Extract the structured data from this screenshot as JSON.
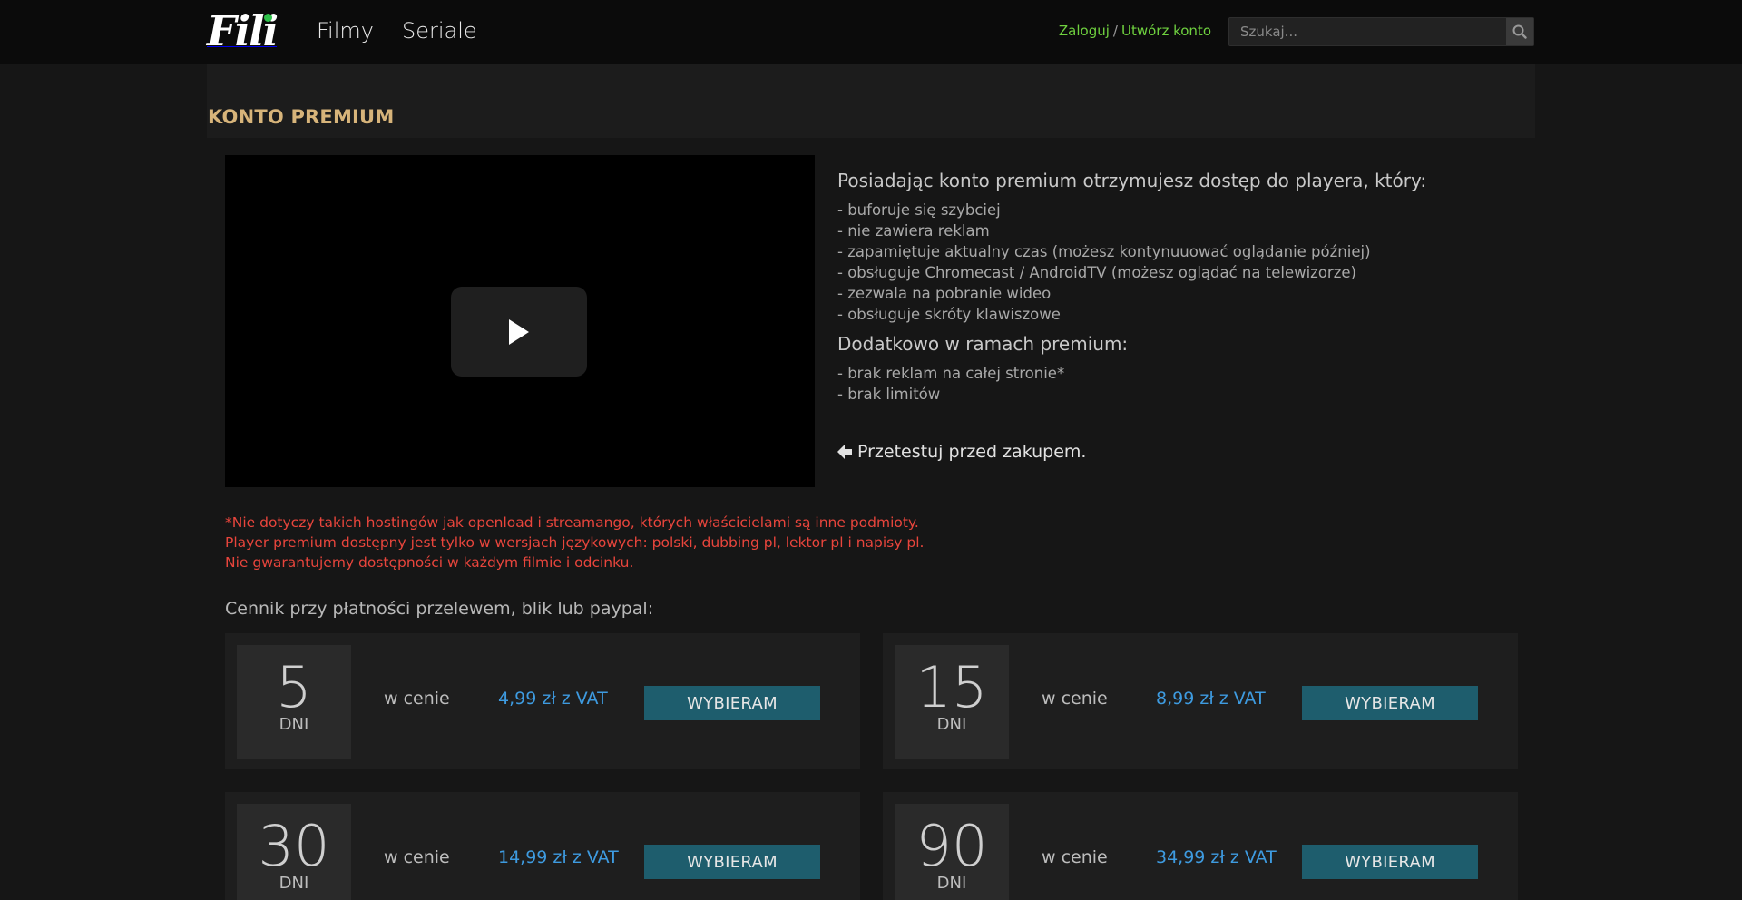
{
  "header": {
    "logo_text": "Fili",
    "nav": [
      {
        "label": "Filmy"
      },
      {
        "label": "Seriale"
      }
    ],
    "auth": {
      "login": "Zaloguj",
      "separator": "/",
      "register": "Utwórz konto"
    },
    "search": {
      "placeholder": "Szukaj..."
    }
  },
  "page": {
    "title": "KONTO PREMIUM",
    "description": {
      "heading": "Posiadając konto premium otrzymujesz dostęp do playera, który:",
      "features": [
        "- buforuje się szybciej",
        "- nie zawiera reklam",
        "- zapamiętuje aktualny czas (możesz kontynuuować oglądanie później)",
        "- obsługuje Chromecast / AndroidTV (możesz oglądać na telewizorze)",
        "- zezwala na pobranie wideo",
        "- obsługuje skróty klawiszowe"
      ],
      "extra_heading": "Dodatkowo w ramach premium:",
      "extras": [
        "- brak reklam na całej stronie*",
        "- brak limitów"
      ]
    },
    "test_link": "Przetestuj przed zakupem.",
    "notice": [
      "*Nie dotyczy takich hostingów jak openload i streamango, których właścicielami są inne podmioty.",
      "Player premium dostępny jest tylko w wersjach językowych: polski, dubbing pl, lektor pl i napisy pl.",
      "Nie gwarantujemy dostępności w każdym filmie i odcinku."
    ],
    "pricing_title": "Cennik przy płatności przelewem, blik lub paypal:",
    "plans": [
      {
        "days": "5",
        "unit": "DNI",
        "in_price": "w cenie",
        "price": "4,99 zł z VAT",
        "button": "WYBIERAM"
      },
      {
        "days": "15",
        "unit": "DNI",
        "in_price": "w cenie",
        "price": "8,99 zł z VAT",
        "button": "WYBIERAM"
      },
      {
        "days": "30",
        "unit": "DNI",
        "in_price": "w cenie",
        "price": "14,99 zł z VAT",
        "button": "WYBIERAM"
      },
      {
        "days": "90",
        "unit": "DNI",
        "in_price": "w cenie",
        "price": "34,99 zł z VAT",
        "button": "WYBIERAM"
      }
    ]
  },
  "colors": {
    "accent_green": "#6fd13f",
    "title_gold": "#d7b47a",
    "price_blue": "#3e9be0",
    "button_teal": "#1e5d6d",
    "notice_red": "#e8453c"
  }
}
